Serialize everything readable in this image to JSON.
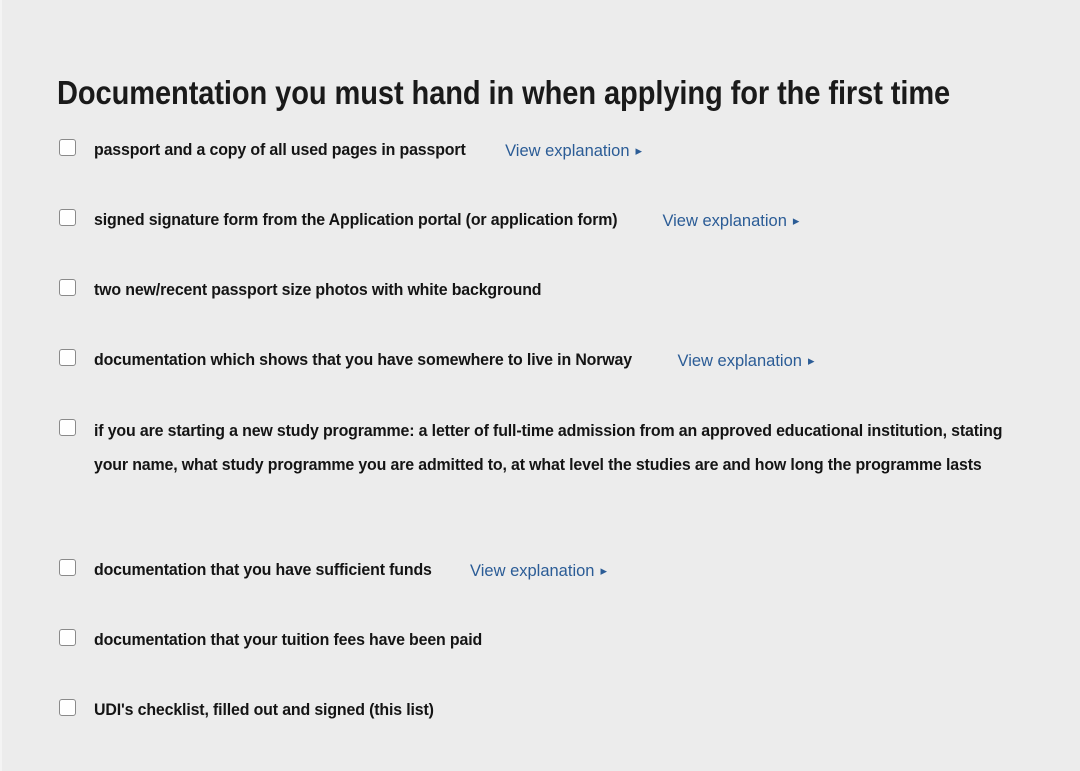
{
  "page": {
    "background_color": "#ececec",
    "title": "Documentation you must hand in when applying for the first time"
  },
  "link_label": "View explanation",
  "link_caret": "▸",
  "link_color": "#2b5c96",
  "checklist": {
    "items": [
      {
        "label": "passport and a copy of all used pages in passport",
        "has_link": true,
        "checked": false,
        "multiline": false
      },
      {
        "label": "signed signature form from the Application portal (or application form)",
        "has_link": true,
        "checked": false,
        "multiline": false
      },
      {
        "label": "two new/recent passport size photos with white background",
        "has_link": false,
        "checked": false,
        "multiline": false
      },
      {
        "label": "documentation which shows that you have somewhere to live in Norway",
        "has_link": true,
        "checked": false,
        "multiline": false
      },
      {
        "label": "if you are starting a new study programme: a letter of full-time admission from an approved educational institution, stating your name, what study programme you are admitted to, at what level the studies are and how long the programme lasts",
        "has_link": false,
        "checked": false,
        "multiline": true
      },
      {
        "label": "documentation that you have sufficient funds",
        "has_link": true,
        "checked": false,
        "multiline": false
      },
      {
        "label": "documentation that your tuition fees have been paid",
        "has_link": false,
        "checked": false,
        "multiline": false
      },
      {
        "label": "UDI's checklist, filled out and signed (this list)",
        "has_link": false,
        "checked": false,
        "multiline": false
      }
    ]
  }
}
